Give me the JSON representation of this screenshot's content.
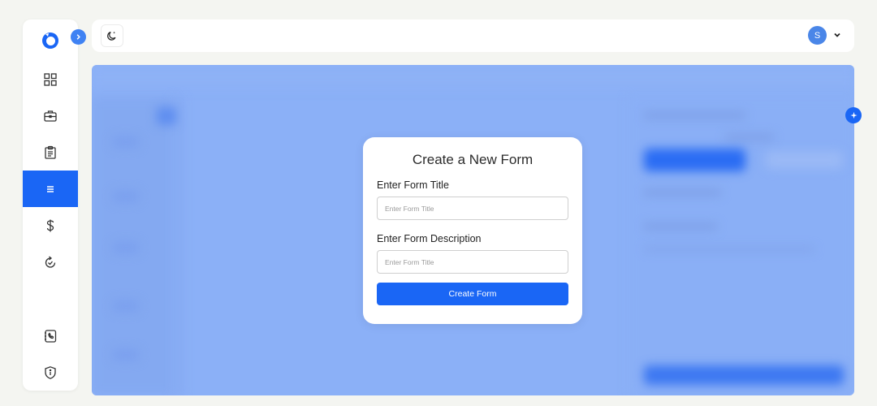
{
  "sidebar": {
    "items": [
      {
        "id": "dashboard",
        "icon": "grid-icon",
        "active": false
      },
      {
        "id": "jobs",
        "icon": "briefcase-icon",
        "active": false
      },
      {
        "id": "tasks",
        "icon": "clipboard-icon",
        "active": false
      },
      {
        "id": "forms",
        "icon": "menu-lines-icon",
        "active": true
      },
      {
        "id": "billing",
        "icon": "dollar-icon",
        "active": false
      },
      {
        "id": "history",
        "icon": "refresh-check-icon",
        "active": false
      },
      {
        "id": "contacts",
        "icon": "phone-book-icon",
        "active": false
      },
      {
        "id": "security",
        "icon": "shield-info-icon",
        "active": false
      }
    ]
  },
  "topbar": {
    "user_initial": "S",
    "theme_icon": "moon-icon"
  },
  "modal": {
    "title": "Create a New Form",
    "title_label": "Enter Form Title",
    "title_placeholder": "Enter Form Title",
    "title_value": "",
    "description_label": "Enter Form Description",
    "description_placeholder": "Enter Form Title",
    "description_value": "",
    "submit_label": "Create Form"
  },
  "colors": {
    "accent": "#1a66f5",
    "overlay": "#8bb0f7",
    "background": "#f4f5f1"
  }
}
